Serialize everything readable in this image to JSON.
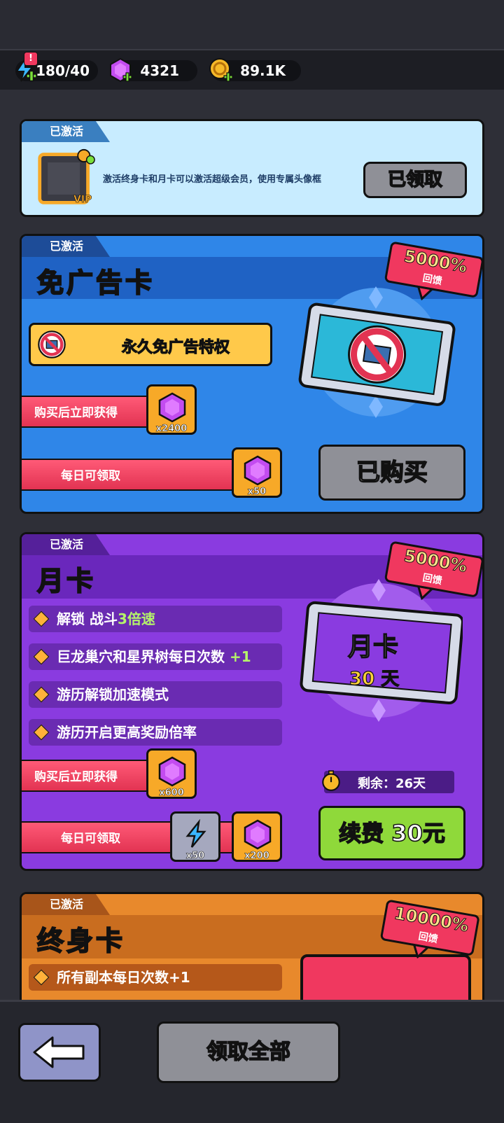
{
  "resources": [
    {
      "icon": "energy-icon",
      "value": "180/40",
      "alert": "!"
    },
    {
      "icon": "gem-icon",
      "value": "4321"
    },
    {
      "icon": "coin-icon",
      "value": "89.1K"
    }
  ],
  "vip_panel": {
    "tag": "已激活",
    "frame_label": "VIP",
    "description": "激活终身卡和月卡可以激活超级会员，使用专属头像框",
    "button": "已领取"
  },
  "noad_card": {
    "tag": "已激活",
    "title": "免广告卡",
    "privilege": "永久免广告特权",
    "badge_percent": "5000%",
    "badge_sub": "回馈",
    "instant_label": "购买后立即获得",
    "instant_qty": "x2400",
    "daily_label": "每日可领取",
    "daily_qty": "x50",
    "button": "已购买"
  },
  "month_card": {
    "tag": "已激活",
    "title": "月卡",
    "features": [
      {
        "text": "解锁 战斗",
        "highlight": "3倍速"
      },
      {
        "text": "巨龙巢穴和星界树每日次数 ",
        "highlight": "+1"
      },
      {
        "text": "游历解锁加速模式",
        "highlight": ""
      },
      {
        "text": "游历开启更高奖励倍率",
        "highlight": ""
      }
    ],
    "ticket_title": "月卡",
    "ticket_days": "30 天",
    "badge_percent": "5000%",
    "badge_sub": "回馈",
    "remaining": "剩余：26天",
    "instant_label": "购买后立即获得",
    "instant_qty": "x600",
    "daily_label": "每日可领取",
    "daily_qty_energy": "x50",
    "daily_qty_gem": "x200",
    "button": "续费 30元"
  },
  "life_card": {
    "tag": "已激活",
    "title": "终身卡",
    "badge_percent": "10000%",
    "badge_sub": "回馈",
    "first_feature": "所有副本每日次数+1"
  },
  "bottom": {
    "claim_all": "领取全部"
  },
  "colors": {
    "blue_card": "#2f86e8",
    "purple_card": "#8a3be0",
    "orange_card": "#e8892c",
    "gold": "#f7a928",
    "pink": "#f0385f",
    "green_button": "#8fd93a",
    "gray_button": "#8f9097"
  }
}
